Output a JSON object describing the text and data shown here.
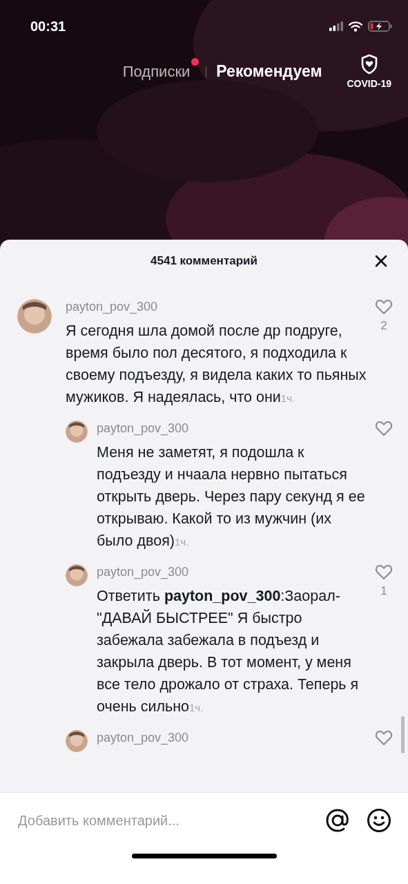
{
  "status_bar": {
    "time": "00:31"
  },
  "feed_tabs": [
    {
      "label": "Подписки",
      "selected": false,
      "new_dot": true
    },
    {
      "label": "Рекомендуем",
      "selected": true,
      "new_dot": false
    }
  ],
  "covid_button": {
    "label": "COVID-19"
  },
  "comments_sheet": {
    "title": "4541 комментарий",
    "comments": [
      {
        "kind": "top",
        "user": "payton_pov_300",
        "text": "Я сегодня шла домой после др подруге, время было пол десятого, я подходила к своему подъезду, я видела каких то пьяных мужиков. Я надеялась, что они",
        "time": "1ч.",
        "likes": "2"
      },
      {
        "kind": "reply",
        "user": "payton_pov_300",
        "text": "Меня не заметят, я подошла к подъезду и нчаала нервно пытаться открыть дверь. Через пару секунд я ее открываю. Какой то из мужчин (их было двоя)",
        "time": "1ч."
      },
      {
        "kind": "reply",
        "user": "payton_pov_300",
        "text": "Ответить **payton_pov_300**:Заорал-\"ДАВАЙ БЫСТРЕЕ\" Я быстро забежала забежала в подъезд и закрыла дверь. В тот момент, у меня все тело дрожало от страха. Теперь я очень сильно",
        "time": "1ч.",
        "likes": "1"
      },
      {
        "kind": "reply",
        "user": "payton_pov_300"
      }
    ]
  },
  "comment_input": {
    "placeholder": "Добавить комментарий..."
  }
}
